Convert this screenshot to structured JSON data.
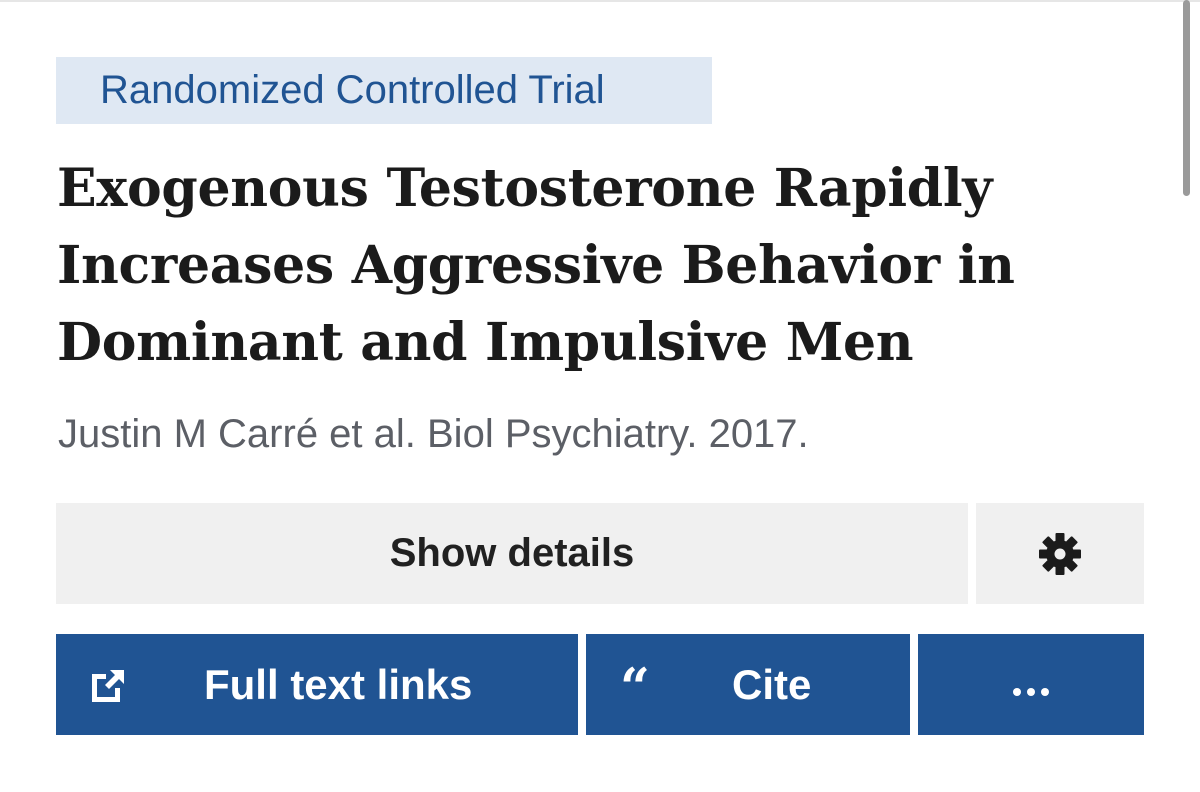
{
  "article": {
    "publication_type": "Randomized Controlled Trial",
    "title": "Exogenous Testosterone Rapidly Increases Aggressive Behavior in Dominant and Impulsive Men",
    "citation": "Justin M Carré et al. Biol Psychiatry. 2017."
  },
  "actions": {
    "show_details_label": "Show details",
    "settings_icon": "gear-icon",
    "full_text_label": "Full text links",
    "full_text_icon": "external-link-icon",
    "cite_label": "Cite",
    "cite_icon": "quote-icon",
    "more_icon": "ellipsis-icon"
  },
  "colors": {
    "brand_blue": "#205493",
    "pub_type_bg": "#dfe8f3",
    "light_button_bg": "#f0f0f0",
    "title_text": "#1b1b1b",
    "meta_text": "#5c5f66"
  }
}
